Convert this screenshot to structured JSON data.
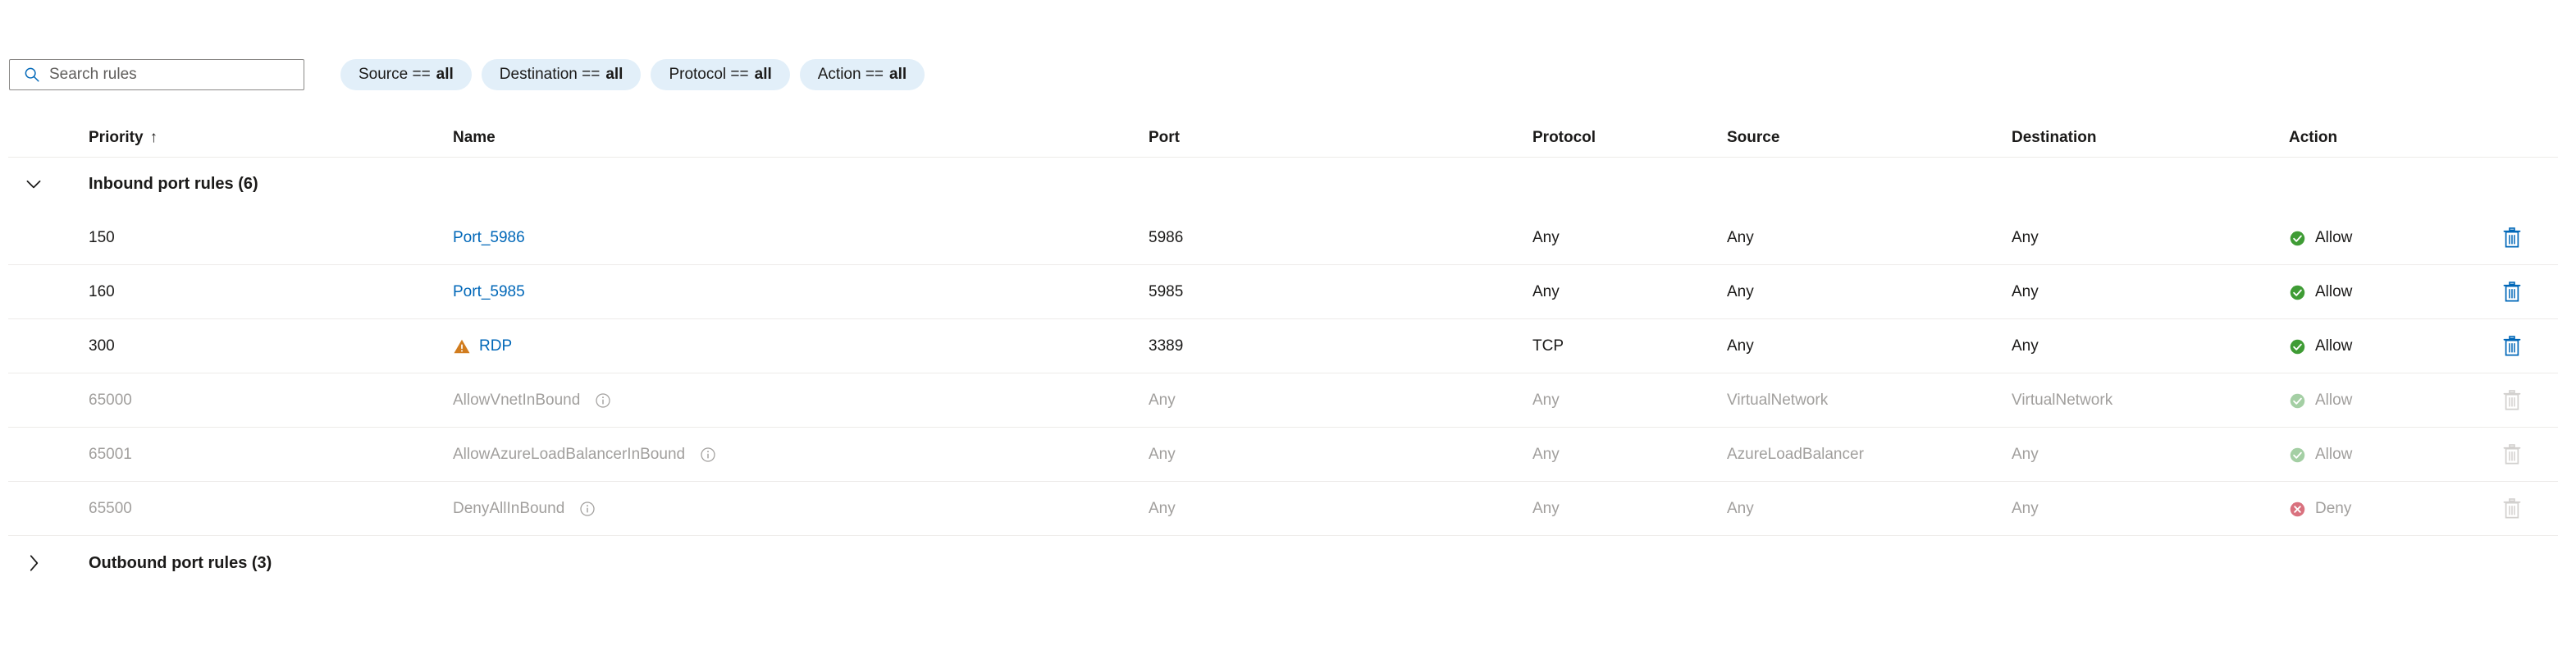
{
  "search": {
    "placeholder": "Search rules",
    "value": "",
    "icon": "search-icon"
  },
  "filters": [
    {
      "label": "Source ==",
      "value": "all"
    },
    {
      "label": "Destination ==",
      "value": "all"
    },
    {
      "label": "Protocol ==",
      "value": "all"
    },
    {
      "label": "Action ==",
      "value": "all"
    }
  ],
  "columns": {
    "priority": "Priority",
    "priority_sort": "↑",
    "name": "Name",
    "port": "Port",
    "protocol": "Protocol",
    "source": "Source",
    "destination": "Destination",
    "action": "Action"
  },
  "colors": {
    "link": "#0067b8",
    "allow": "#107c10",
    "allow_dim": "#a4cfa4",
    "deny": "#d9717e",
    "warning": "#d17c1e",
    "pill_bg": "#e2eff9",
    "muted_text": "#a19f9d",
    "divider": "#edebe9"
  },
  "groups": [
    {
      "label": "Inbound port rules (6)",
      "expanded": true,
      "chevron": "chevron-down-icon",
      "rows": [
        {
          "priority": "150",
          "name": "Port_5986",
          "port": "5986",
          "protocol": "Any",
          "source": "Any",
          "destination": "Any",
          "action": "Allow",
          "action_icon": "check-circle-icon",
          "name_link": true,
          "warning": false,
          "info": false,
          "dimmed": false,
          "deletable": true
        },
        {
          "priority": "160",
          "name": "Port_5985",
          "port": "5985",
          "protocol": "Any",
          "source": "Any",
          "destination": "Any",
          "action": "Allow",
          "action_icon": "check-circle-icon",
          "name_link": true,
          "warning": false,
          "info": false,
          "dimmed": false,
          "deletable": true
        },
        {
          "priority": "300",
          "name": "RDP",
          "port": "3389",
          "protocol": "TCP",
          "source": "Any",
          "destination": "Any",
          "action": "Allow",
          "action_icon": "check-circle-icon",
          "name_link": true,
          "warning": true,
          "warning_icon": "warning-triangle-icon",
          "info": false,
          "dimmed": false,
          "deletable": true
        },
        {
          "priority": "65000",
          "name": "AllowVnetInBound",
          "port": "Any",
          "protocol": "Any",
          "source": "VirtualNetwork",
          "destination": "VirtualNetwork",
          "action": "Allow",
          "action_icon": "check-circle-icon",
          "name_link": false,
          "warning": false,
          "info": true,
          "info_icon": "info-circle-icon",
          "dimmed": true,
          "deletable": false
        },
        {
          "priority": "65001",
          "name": "AllowAzureLoadBalancerInBound",
          "port": "Any",
          "protocol": "Any",
          "source": "AzureLoadBalancer",
          "destination": "Any",
          "action": "Allow",
          "action_icon": "check-circle-icon",
          "name_link": false,
          "warning": false,
          "info": true,
          "info_icon": "info-circle-icon",
          "dimmed": true,
          "deletable": false
        },
        {
          "priority": "65500",
          "name": "DenyAllInBound",
          "port": "Any",
          "protocol": "Any",
          "source": "Any",
          "destination": "Any",
          "action": "Deny",
          "action_icon": "deny-circle-icon",
          "name_link": false,
          "warning": false,
          "info": true,
          "info_icon": "info-circle-icon",
          "dimmed": true,
          "deletable": false
        }
      ]
    },
    {
      "label": "Outbound port rules (3)",
      "expanded": false,
      "chevron": "chevron-right-icon",
      "rows": []
    }
  ]
}
